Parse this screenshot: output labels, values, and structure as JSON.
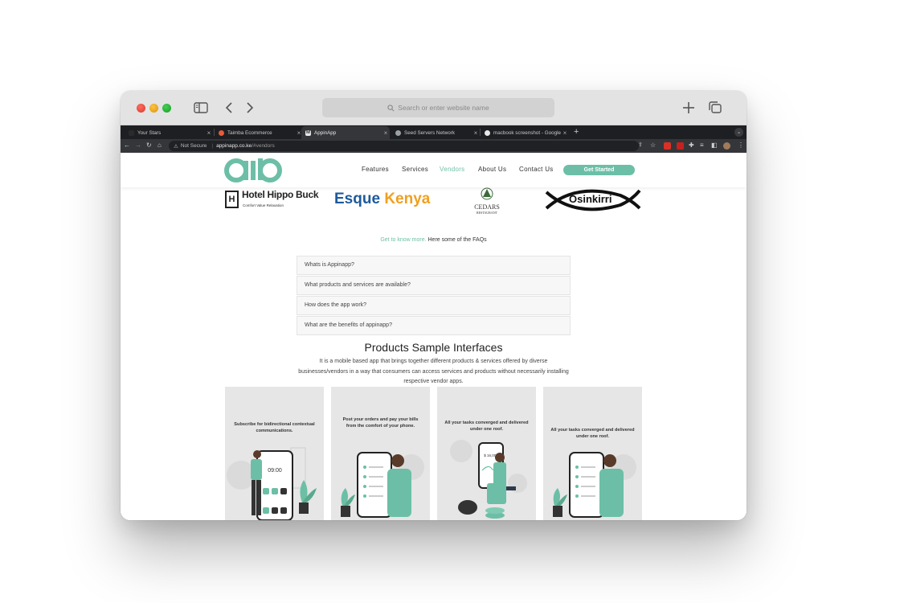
{
  "safari": {
    "address_placeholder": "Search or enter website name"
  },
  "chrome_tabs": [
    {
      "title": "Your Stars",
      "favicon_color": "#2b2b2b"
    },
    {
      "title": "Taimba Ecommerce",
      "favicon_color": "#e85a3b"
    },
    {
      "title": "AppinApp",
      "favicon_color": "#e8e8e8",
      "favicon_text": "M"
    },
    {
      "title": "Seed Servers Network",
      "favicon_color": "#9aa0a6"
    },
    {
      "title": "macbook screenshot - Google",
      "favicon_color": "#e8e8e8"
    }
  ],
  "chrome_url": {
    "security_label": "Not Secure",
    "host": "appinapp.co.ke",
    "path": "/#vendors"
  },
  "site": {
    "logo_text": "aib",
    "nav": [
      "Features",
      "Services",
      "Vendors",
      "About Us",
      "Contact Us"
    ],
    "active_nav": "Vendors",
    "cta_label": "Get Started",
    "accent_color": "#6cbfa6"
  },
  "partners": [
    {
      "name": "Hotel Hippo Buck",
      "tagline": "Comfort Value Relaxation"
    },
    {
      "name": "Esque Kenya"
    },
    {
      "name": "CEDARS",
      "tagline": "RESTAURANT"
    },
    {
      "name": "Osinkirri"
    }
  ],
  "faq": {
    "intro_accent": "Get to know more.",
    "intro_rest": "Here some of the FAQs",
    "items": [
      "Whats is Appinapp?",
      "What products and services are available?",
      "How does the app work?",
      "What are the benefits of appinapp?"
    ]
  },
  "products": {
    "title": "Products Sample Interfaces",
    "description": "It is a mobile based app that brings together different products & services offered by diverse businesses/vendors in a way that consumers can access services and products without necessarily installing respective vendor apps.",
    "cards": [
      {
        "caption": "Subscribe for bidirectional contextual communications.",
        "phone_time": "09:00"
      },
      {
        "caption": "Post your orders and pay your bills from the comfort of your phone."
      },
      {
        "caption": "All your tasks converged and delivered under one roof.",
        "phone_amount": "$ 16,000"
      },
      {
        "caption": "All your tasks converged and delivered under one roof."
      }
    ]
  }
}
